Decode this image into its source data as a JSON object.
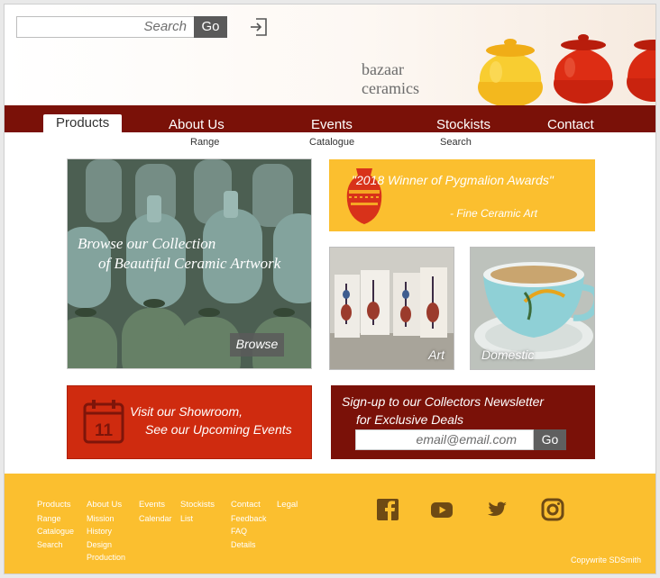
{
  "header": {
    "search_placeholder": "Search",
    "search_button": "Go",
    "brand_line1": "bazaar",
    "brand_line2": "ceramics",
    "login_icon": "sign-in-icon"
  },
  "nav": {
    "items": [
      {
        "label": "Products",
        "active": true
      },
      {
        "label": "About Us",
        "active": false
      },
      {
        "label": "Events",
        "active": false
      },
      {
        "label": "Stockists",
        "active": false
      },
      {
        "label": "Contact",
        "active": false
      }
    ],
    "subitems": [
      "Range",
      "Catalogue",
      "Search"
    ]
  },
  "hero": {
    "line1": "Browse our Collection",
    "line2": "of Beautiful Ceramic Artwork",
    "button": "Browse"
  },
  "award": {
    "line1": "\"2018 Winner of  Pygmalion Awards\"",
    "line2": "- Fine Ceramic Art"
  },
  "tiles": {
    "art": "Art",
    "domestic": "Domestic"
  },
  "showroom": {
    "line1": "Visit our Showroom,",
    "line2": "See our Upcoming Events",
    "calendar_day": "11"
  },
  "newsletter": {
    "line1": "Sign-up to our Collectors Newsletter",
    "line2": "for Exclusive Deals",
    "email_placeholder": "email@email.com",
    "button": "Go"
  },
  "footer": {
    "columns": [
      {
        "heading": "Products",
        "links": [
          "Range",
          "Catalogue",
          "Search"
        ]
      },
      {
        "heading": "About Us",
        "links": [
          "Mission",
          "History",
          "Design",
          "Production"
        ]
      },
      {
        "heading": "Events",
        "links": [
          "Calendar"
        ]
      },
      {
        "heading": "Stockists",
        "links": [
          "List"
        ]
      },
      {
        "heading": "Contact",
        "links": [
          "Feedback",
          "FAQ",
          "Details"
        ]
      },
      {
        "heading": "Legal",
        "links": []
      }
    ],
    "social": [
      "facebook-icon",
      "youtube-icon",
      "twitter-icon",
      "instagram-icon"
    ],
    "copyright": "Copywrite SDSmith"
  },
  "colors": {
    "maroon": "#7a1108",
    "red": "#cf2b0f",
    "yellow": "#fbbf2f",
    "dark_icon": "#6e4a14"
  }
}
